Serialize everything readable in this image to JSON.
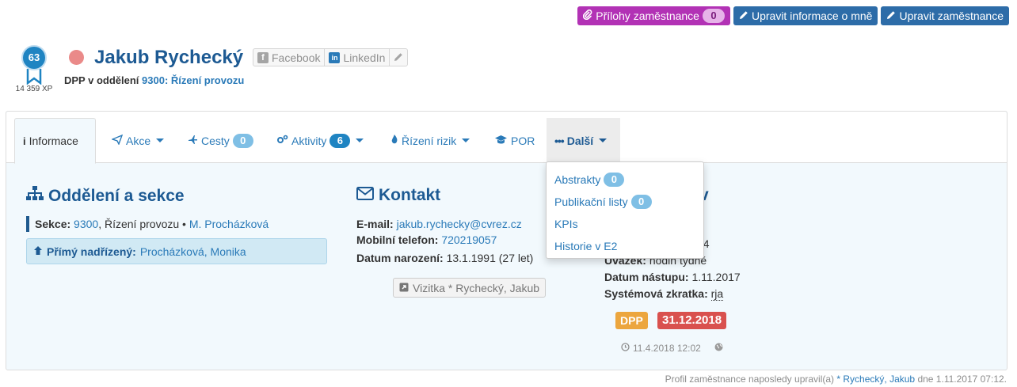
{
  "top_buttons": {
    "attachments_label": "Přílohy zaměstnance",
    "attachments_count": "0",
    "edit_me_label": "Upravit informace o mně",
    "edit_employee_label": "Upravit zaměstnance"
  },
  "profile": {
    "level": "63",
    "xp": "14 359 XP",
    "name": "Jakub Rychecký",
    "dept_prefix": "DPP v oddělení",
    "dept_link": "9300: Řízení provozu",
    "social": {
      "facebook": "Facebook",
      "linkedin": "LinkedIn"
    }
  },
  "tabs": [
    {
      "label": "Informace"
    },
    {
      "label": "Akce"
    },
    {
      "label": "Cesty",
      "count": "0"
    },
    {
      "label": "Aktivity",
      "count": "6"
    },
    {
      "label": "Řízení rizik"
    },
    {
      "label": "POR"
    },
    {
      "label": "Další"
    }
  ],
  "dropdown": {
    "items": [
      {
        "label": "Abstrakty",
        "count": "0"
      },
      {
        "label": "Publikační listy",
        "count": "0"
      },
      {
        "label": "KPIs"
      },
      {
        "label": "Historie v E2"
      }
    ]
  },
  "departments": {
    "title": "Oddělení a sekce",
    "sekce_label": "Sekce:",
    "sekce_code": "9300",
    "sekce_name": ", Řízení provozu •",
    "sekce_head": "M. Procházková",
    "supervisor_label": "Přímý nadřízený:",
    "supervisor_name": "Procházková, Monika"
  },
  "contact": {
    "title": "Kontakt",
    "email_label": "E-mail:",
    "email": "jakub.rychecky@cvrez.cz",
    "phone_label": "Mobilní telefon:",
    "phone": "720219057",
    "birth_label": "Datum narození:",
    "birth": "13.1.1991 (27 let)",
    "vcard": "Vizitka * Rychecký, Jakub"
  },
  "employment": {
    "title_tail": "v",
    "number_tail": "54",
    "uvazek_label": "Úvazek:",
    "uvazek": "hodin týdně",
    "start_label": "Datum nástupu:",
    "start": "1.11.2017",
    "abbr_label": "Systémová zkratka:",
    "abbr": "rja",
    "contract_type": "DPP",
    "contract_end": "31.12.2018",
    "updated": "11.4.2018 12:02"
  },
  "footer": {
    "prefix": "Profil zaměstnance naposledy upravil(a)",
    "editor": "* Rychecký, Jakub",
    "suffix": "dne 1.11.2017 07:12."
  },
  "colors": {
    "accent": "#1d5a93",
    "link": "#2a7ab8",
    "purple": "#b232b5",
    "status_dot": "#ea8a89",
    "dpp": "#eca63e",
    "date_tag": "#d9514e"
  }
}
